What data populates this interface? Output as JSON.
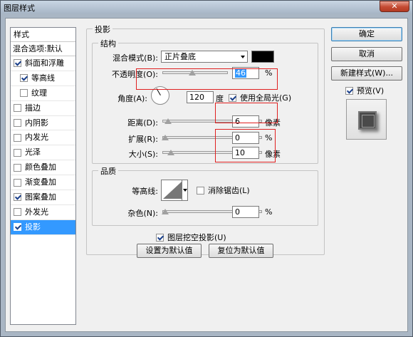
{
  "window": {
    "title": "图层样式",
    "close": "✕"
  },
  "sidebar": {
    "header": "样式",
    "blend_options": "混合选项:默认",
    "items": [
      {
        "label": "斜面和浮雕",
        "checked": true,
        "sub": false,
        "active": false
      },
      {
        "label": "等高线",
        "checked": true,
        "sub": true,
        "active": false
      },
      {
        "label": "纹理",
        "checked": false,
        "sub": true,
        "active": false
      },
      {
        "label": "描边",
        "checked": false,
        "sub": false,
        "active": false
      },
      {
        "label": "内阴影",
        "checked": false,
        "sub": false,
        "active": false
      },
      {
        "label": "内发光",
        "checked": false,
        "sub": false,
        "active": false
      },
      {
        "label": "光泽",
        "checked": false,
        "sub": false,
        "active": false
      },
      {
        "label": "颜色叠加",
        "checked": false,
        "sub": false,
        "active": false
      },
      {
        "label": "渐变叠加",
        "checked": false,
        "sub": false,
        "active": false
      },
      {
        "label": "图案叠加",
        "checked": true,
        "sub": false,
        "active": false
      },
      {
        "label": "外发光",
        "checked": false,
        "sub": false,
        "active": false
      },
      {
        "label": "投影",
        "checked": true,
        "sub": false,
        "active": true
      }
    ]
  },
  "panel": {
    "title": "投影",
    "structure": {
      "title": "结构",
      "blend_mode_label": "混合模式(B):",
      "blend_mode_value": "正片叠底",
      "blend_color": "#000000",
      "opacity_label": "不透明度(O):",
      "opacity_value": "46",
      "opacity_level": 0.46,
      "percent": "%",
      "angle_label": "角度(A):",
      "angle_value": "120",
      "angle_unit": "度",
      "global_light_label": "使用全局光(G)",
      "distance_label": "距离(D):",
      "distance_value": "6",
      "spread_label": "扩展(R):",
      "spread_value": "0",
      "size_label": "大小(S):",
      "size_value": "10",
      "pixel_unit": "像素"
    },
    "quality": {
      "title": "品质",
      "contour_label": "等高线:",
      "antialias_label": "消除锯齿(L)",
      "noise_label": "杂色(N):",
      "noise_value": "0"
    },
    "knockout_label": "图层挖空投影(U)",
    "set_default": "设置为默认值",
    "reset_default": "复位为默认值"
  },
  "buttons": {
    "ok": "确定",
    "cancel": "取消",
    "new_style": "新建样式(W)...",
    "preview_label": "预览(V)"
  }
}
